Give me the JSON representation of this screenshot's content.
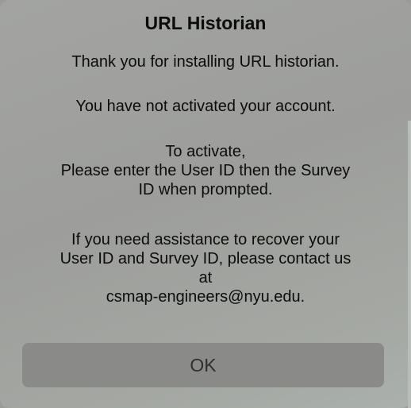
{
  "dialog": {
    "title": "URL Historian",
    "paragraph1": "Thank you for installing URL historian.",
    "paragraph2": "You have not activated your account.",
    "paragraph3_line1": "To activate,",
    "paragraph3_line2": "Please enter the User ID then the Survey",
    "paragraph3_line3": "ID when prompted.",
    "paragraph4_line1": "If you need assistance to recover your",
    "paragraph4_line2": "User ID and Survey ID, please contact us",
    "paragraph4_line3": "at",
    "paragraph4_line4": "csmap-engineers@nyu.edu.",
    "ok_label": "OK"
  },
  "colors": {
    "background": "#a0a19f",
    "button": "#8a8b89",
    "text": "#0c0c0c"
  }
}
